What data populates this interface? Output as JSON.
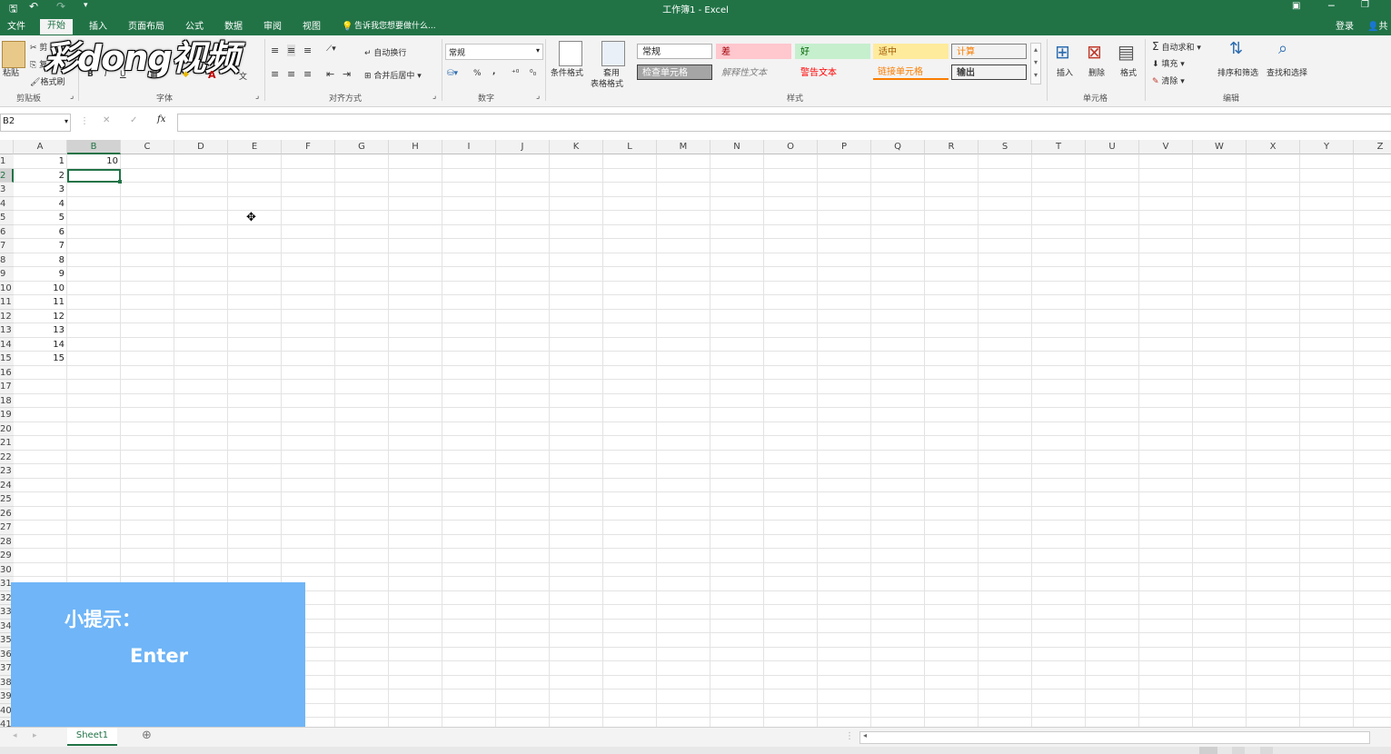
{
  "title": "工作簿1 - Excel",
  "tabs": [
    "文件",
    "开始",
    "插入",
    "页面布局",
    "公式",
    "数据",
    "审阅",
    "视图"
  ],
  "active_tab": "开始",
  "tell_me": "告诉我您想要做什么...",
  "login": "登录",
  "share": "共",
  "watermark": "彩dong视频",
  "ribbon": {
    "clipboard": {
      "paste": "粘贴",
      "cut": "剪",
      "copy": "复",
      "format_painter": "格式刷",
      "label": "剪贴板"
    },
    "font": {
      "label": "字体",
      "bold": "B",
      "italic": "I",
      "underline": "U",
      "font_color": "A"
    },
    "alignment": {
      "wrap": "自动换行",
      "merge": "合并后居中",
      "label": "对齐方式"
    },
    "number": {
      "format": "常规",
      "percent": "%",
      "comma": ",",
      "label": "数字"
    },
    "styles_buttons": {
      "conditional": "条件格式",
      "table_format_1": "套用",
      "table_format_2": "表格格式",
      "label": "样式"
    },
    "style_cells": [
      {
        "text": "常规",
        "bg": "#ffffff",
        "color": "#222222",
        "border": "#b0b0b0"
      },
      {
        "text": "差",
        "bg": "#ffc7ce",
        "color": "#9c0006",
        "border": "#ffc7ce"
      },
      {
        "text": "好",
        "bg": "#c6efce",
        "color": "#006100",
        "border": "#c6efce"
      },
      {
        "text": "适中",
        "bg": "#ffeb9c",
        "color": "#9c5700",
        "border": "#ffeb9c"
      },
      {
        "text": "计算",
        "bg": "#f2f2f2",
        "color": "#fa7d00",
        "border": "#7f7f7f"
      },
      {
        "text": "检查单元格",
        "bg": "#a5a5a5",
        "color": "#ffffff",
        "border": "#3f3f3f"
      },
      {
        "text": "解释性文本",
        "bg": "#f3f3f3",
        "color": "#7f7f7f",
        "border": "#f3f3f3"
      },
      {
        "text": "警告文本",
        "bg": "#f3f3f3",
        "color": "#ff0000",
        "border": "#f3f3f3"
      },
      {
        "text": "链接单元格",
        "bg": "#f3f3f3",
        "color": "#fa7d00",
        "border": "#f3f3f3"
      },
      {
        "text": "输出",
        "bg": "#f2f2f2",
        "color": "#3f3f3f",
        "border": "#3f3f3f"
      }
    ],
    "cells": {
      "insert": "插入",
      "delete": "删除",
      "format": "格式",
      "label": "单元格"
    },
    "editing": {
      "autosum": "自动求和",
      "fill": "填充",
      "clear": "清除",
      "sort": "排序和筛选",
      "find": "查找和选择",
      "label": "编辑"
    }
  },
  "name_box": "B2",
  "fx": "fx",
  "columns": [
    "A",
    "B",
    "C",
    "D",
    "E",
    "F",
    "G",
    "H",
    "I",
    "J",
    "K",
    "L",
    "M",
    "N",
    "O",
    "P",
    "Q",
    "R",
    "S",
    "T",
    "U",
    "V",
    "W",
    "X",
    "Y",
    "Z"
  ],
  "row_numbers": [
    "1",
    "2",
    "3",
    "4",
    "5",
    "6",
    "7",
    "8",
    "9",
    "10",
    "11",
    "12",
    "13",
    "14",
    "15",
    "16",
    "17",
    "18",
    "19",
    "20",
    "21",
    "22",
    "23",
    "24",
    "25",
    "26",
    "27",
    "28",
    "29",
    "30",
    "31",
    "32",
    "33",
    "34",
    "35",
    "36",
    "37",
    "38",
    "39",
    "40",
    "41"
  ],
  "col_a_values": [
    "1",
    "2",
    "3",
    "4",
    "5",
    "6",
    "7",
    "8",
    "9",
    "10",
    "11",
    "12",
    "13",
    "14",
    "15"
  ],
  "b1_value": "10",
  "tip": {
    "title": "小提示：",
    "text": "Enter"
  },
  "sheet_tab": "Sheet1",
  "colors": {
    "excel_green": "#217346",
    "selection": "#217346",
    "tip_bg": "#6fb5f7"
  }
}
